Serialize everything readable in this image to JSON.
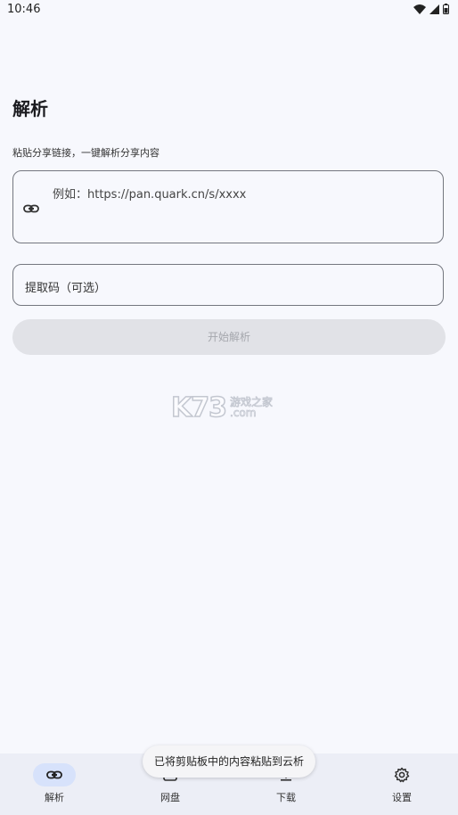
{
  "status_bar": {
    "time": "10:46",
    "icons": [
      "wifi-icon",
      "signal-icon",
      "battery-icon"
    ]
  },
  "page": {
    "title": "解析",
    "subtitle": "粘贴分享链接，一键解析分享内容"
  },
  "link_input": {
    "icon": "link-icon",
    "placeholder": "例如：https://pan.quark.cn/s/xxxx",
    "value": ""
  },
  "code_input": {
    "placeholder": "提取码（可选）",
    "value": ""
  },
  "start_button": {
    "label": "开始解析",
    "enabled": false
  },
  "watermark": {
    "main": "K73",
    "cn": "游戏之家",
    "com": ".com"
  },
  "bottom_nav": {
    "items": [
      {
        "label": "解析",
        "icon": "link-icon",
        "active": true
      },
      {
        "label": "网盘",
        "icon": "cloud-drive-icon",
        "active": false
      },
      {
        "label": "下载",
        "icon": "download-icon",
        "active": false
      },
      {
        "label": "设置",
        "icon": "gear-icon",
        "active": false
      }
    ]
  },
  "toast": {
    "message": "已将剪贴板中的内容粘贴到云析"
  },
  "colors": {
    "background": "#f7f8fd",
    "nav_background": "#eceef6",
    "nav_active_pill": "#d7e2fb",
    "button_disabled": "#e1e2e7",
    "outline": "#74777f"
  }
}
